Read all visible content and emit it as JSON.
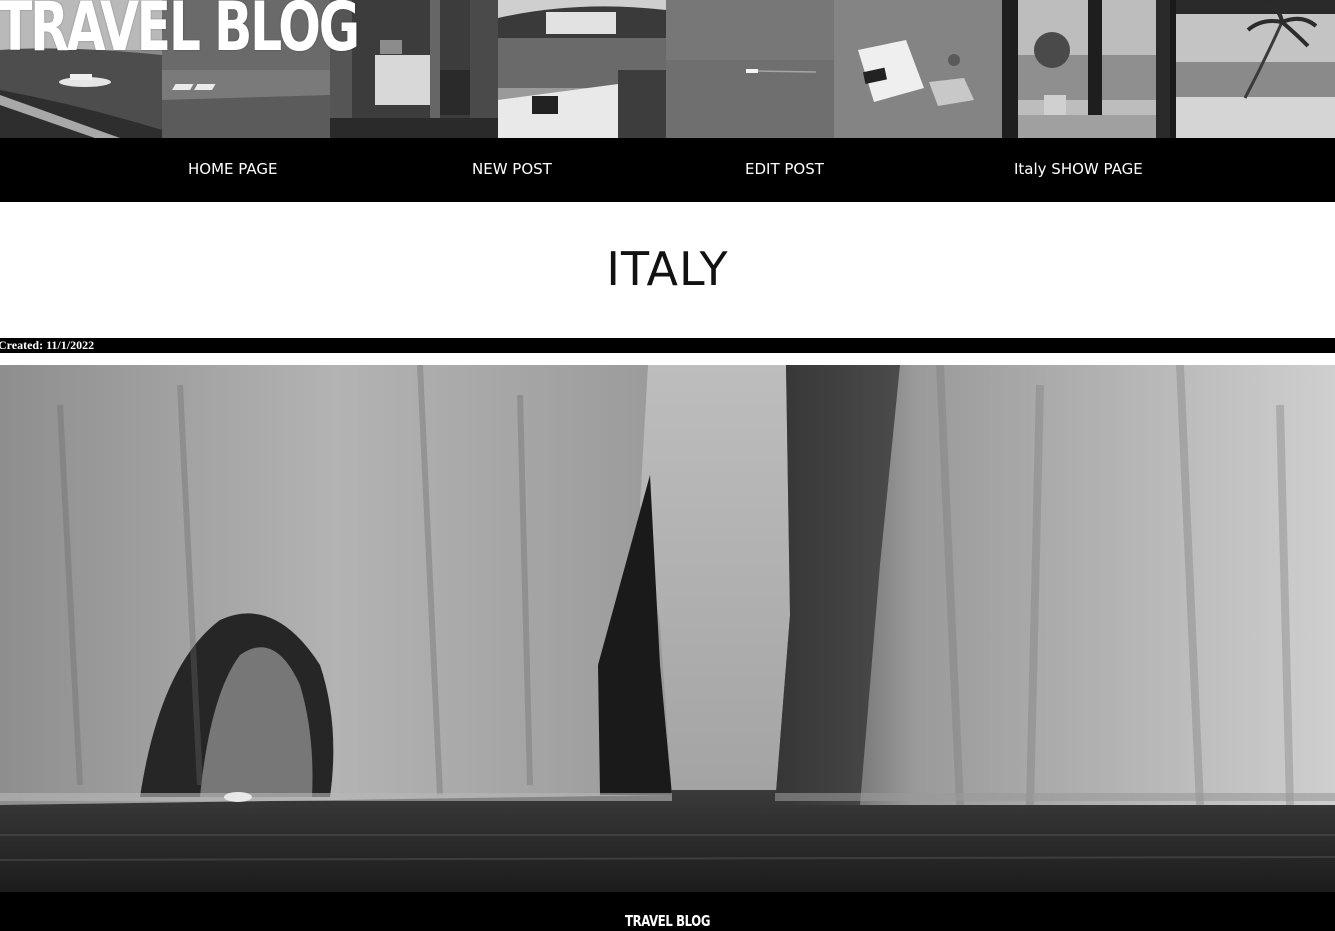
{
  "header": {
    "brand": "TRAVEL BLOG",
    "photos": [
      "coastal-road-yacht-photo",
      "beach-loungers-photo",
      "dining-table-window-photo",
      "lakeside-villa-boat-photo",
      "speedboat-open-sea-photo",
      "beach-bag-sand-photo",
      "balcony-sea-view-photo",
      "palm-tree-beach-photo"
    ]
  },
  "nav": {
    "items": [
      "HOME PAGE",
      "NEW POST",
      "EDIT POST",
      "Italy SHOW PAGE"
    ]
  },
  "post": {
    "title": "ITALY",
    "created_label": "Created: 11/1/2022",
    "image": "capri-sea-rock-arch-photo"
  },
  "footer": {
    "brand": "TRAVEL BLOG"
  },
  "colors": {
    "nav_background": "#000000",
    "nav_text": "#ffffff",
    "page_background": "#ffffff",
    "title_text": "#111111"
  }
}
